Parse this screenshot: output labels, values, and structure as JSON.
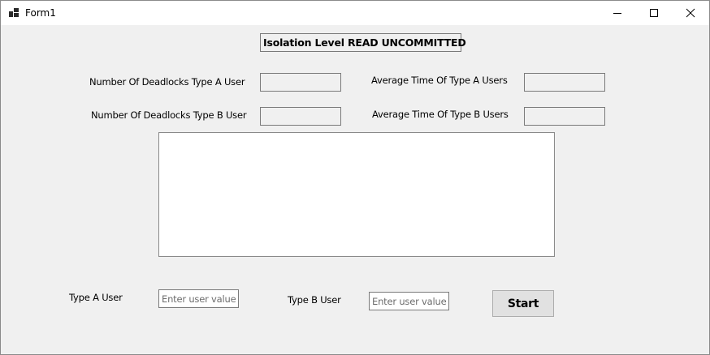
{
  "window": {
    "title": "Form1",
    "icon": "windows-form-icon",
    "controls": {
      "minimize": "minimize-icon",
      "maximize": "maximize-icon",
      "close": "close-icon"
    }
  },
  "form": {
    "isolation_label": "Isolation Level READ UNCOMMITTED",
    "stats": {
      "deadlocks_a_label": "Number Of Deadlocks Type A User",
      "deadlocks_b_label": "Number Of Deadlocks Type B User",
      "avg_time_a_label": "Average Time Of Type A Users",
      "avg_time_b_label": "Average Time Of Type B Users",
      "deadlocks_a_value": "",
      "deadlocks_b_value": "",
      "avg_time_a_value": "",
      "avg_time_b_value": ""
    },
    "log_text": "",
    "type_a": {
      "label": "Type A User",
      "placeholder": "Enter user value",
      "value": ""
    },
    "type_b": {
      "label": "Type B User",
      "placeholder": "Enter user value",
      "value": ""
    },
    "start_label": "Start"
  }
}
